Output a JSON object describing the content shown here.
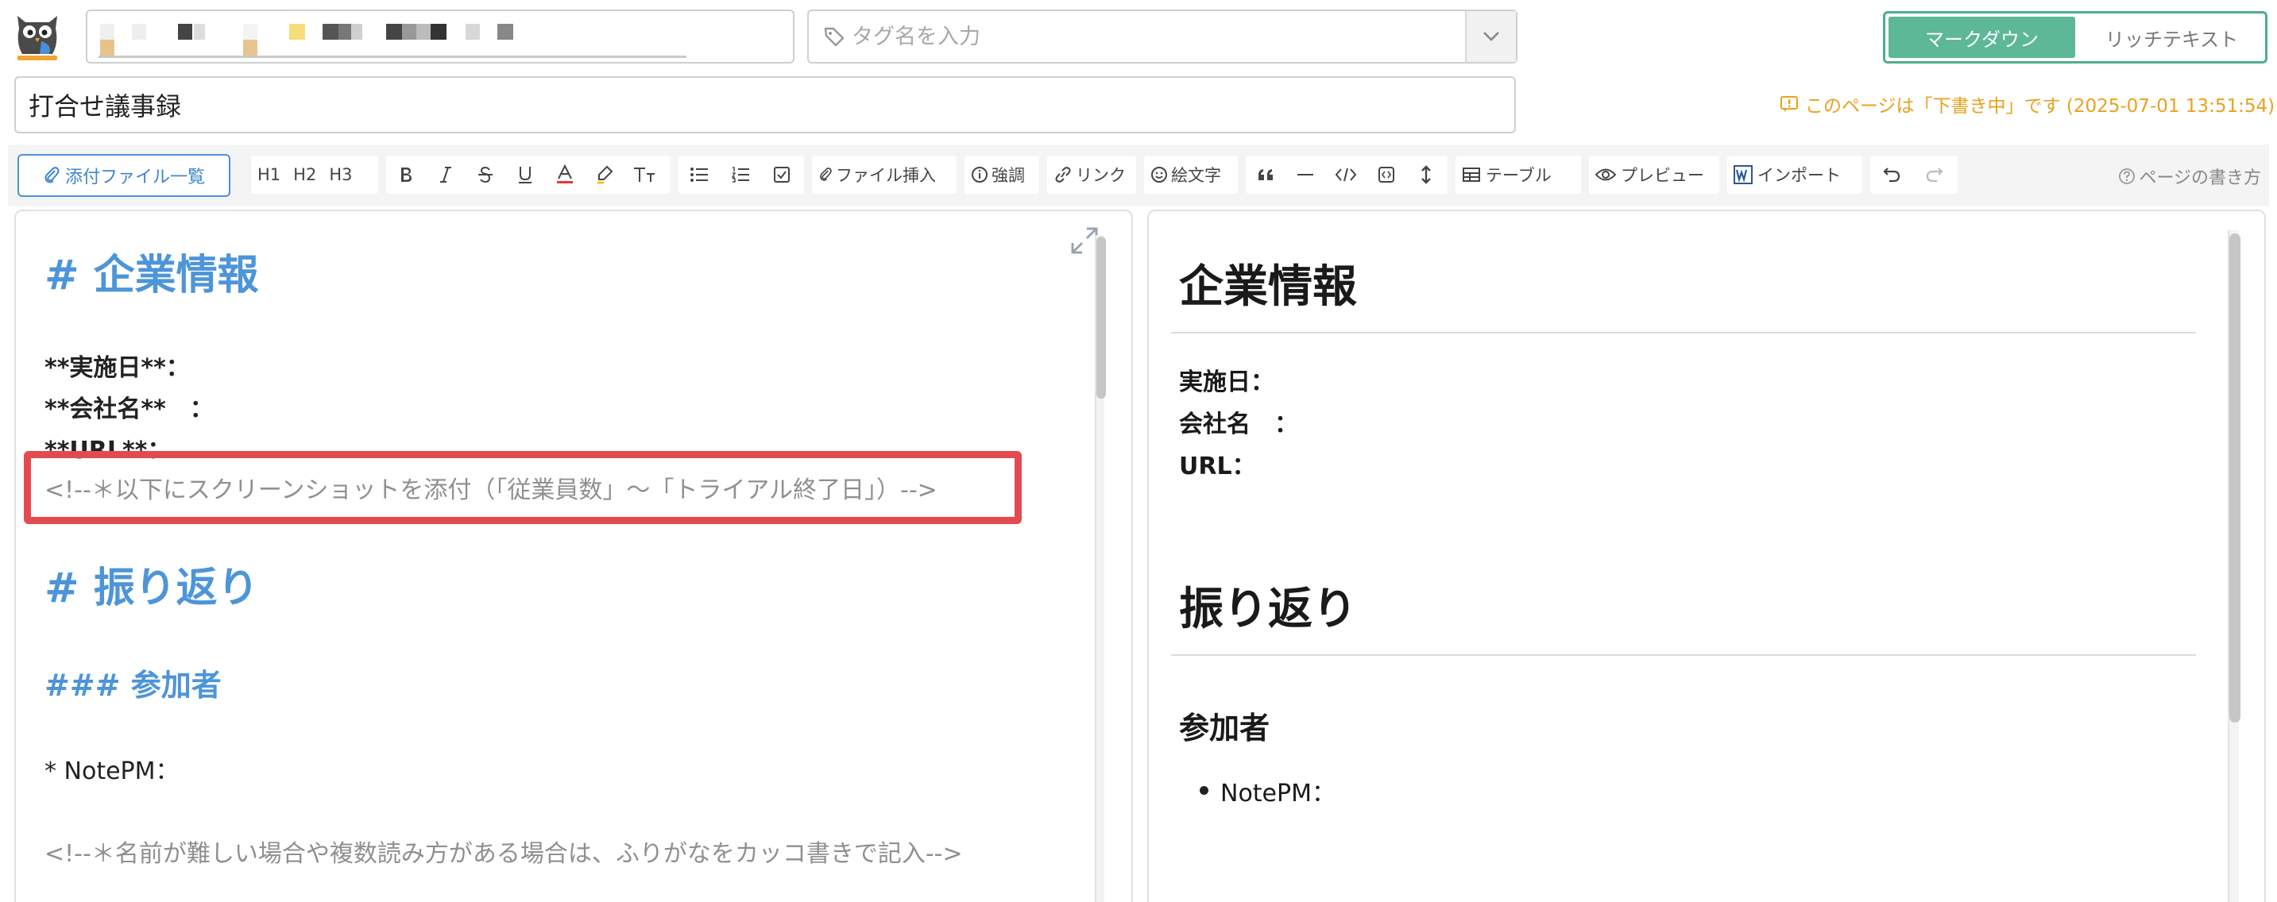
{
  "header": {
    "breadcrumb_label": "Breadcrumb (blurred)",
    "tag_placeholder": "タグ名を入力",
    "mode_markdown": "マークダウン",
    "mode_richtext": "リッチテキスト"
  },
  "page": {
    "title": "打合せ議事録",
    "draft_status": "このページは「下書き中」です (2025-07-01 13:51:54)"
  },
  "toolbar": {
    "attach_list": "添付ファイル一覧",
    "h1": "H1",
    "h2": "H2",
    "h3": "H3",
    "file_insert": "ファイル挿入",
    "emphasis": "強調",
    "link": "リンク",
    "emoji": "絵文字",
    "table": "テーブル",
    "preview": "プレビュー",
    "import": "インポート",
    "help": "ページの書き方"
  },
  "editor": {
    "h1_company": "# 企業情報",
    "date_line": "**実施日**：",
    "company_line": "**会社名**　：",
    "url_line": "**URL**：",
    "comment_screenshot": "<!--＊以下にスクリーンショットを添付（「従業員数」〜「トライアル終了日」）-->",
    "h1_review": "# 振り返り",
    "h3_participants": "### 参加者",
    "notepm_line": "* NotePM：",
    "comment_name": "<!--＊名前が難しい場合や複数読み方がある場合は、ふりがなをカッコ書きで記入-->"
  },
  "preview": {
    "h1_company": "企業情報",
    "date_label": "実施日：",
    "company_label": "会社名　：",
    "url_label": "URL：",
    "h1_review": "振り返り",
    "h3_participants": "参加者",
    "notepm_item": "NotePM："
  },
  "colors": {
    "accent_green": "#5cb897",
    "link_blue": "#4a90d9",
    "heading_blue": "#4d95d8",
    "draft_orange": "#e8a21e",
    "highlight_red": "#e34a4f"
  },
  "icons": [
    "owl-logo-icon",
    "tag-icon",
    "chevron-down-icon",
    "paperclip-icon",
    "bold-icon",
    "italic-icon",
    "strikethrough-icon",
    "underline-icon",
    "font-color-icon",
    "highlighter-icon",
    "text-size-icon",
    "bullet-list-icon",
    "numbered-list-icon",
    "checkbox-icon",
    "info-icon",
    "link-icon",
    "smile-icon",
    "quote-icon",
    "horizontal-rule-icon",
    "code-icon",
    "code-block-icon",
    "line-height-icon",
    "table-icon",
    "eye-icon",
    "word-icon",
    "undo-icon",
    "redo-icon",
    "help-icon",
    "expand-icon",
    "draft-comment-icon"
  ]
}
